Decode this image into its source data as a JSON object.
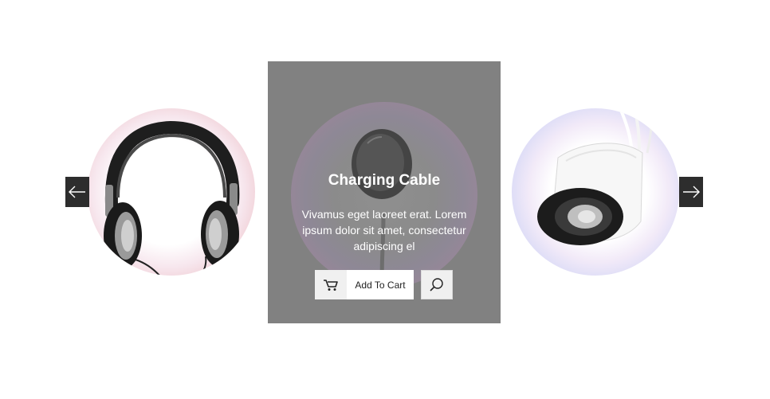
{
  "carousel": {
    "prev_icon": "arrow-left-icon",
    "next_icon": "arrow-right-icon",
    "featured": {
      "title": "Charging Cable",
      "description": "Vivamus eget laoreet erat. Lorem ipsum dolor sit amet, consectetur adipiscing el",
      "add_to_cart_label": "Add To Cart",
      "cart_icon": "cart-icon",
      "search_icon": "search-icon",
      "image": "charging-cable-image"
    },
    "left_item": {
      "image": "headphones-image"
    },
    "right_item": {
      "image": "speaker-image"
    },
    "edge_text": [
      ":",
      ":",
      "."
    ]
  },
  "colors": {
    "overlay": "#818181",
    "arrow_bg": "#2d2d2d",
    "button_bg": "#ffffff",
    "icon_box_bg": "#f0f0f0"
  }
}
